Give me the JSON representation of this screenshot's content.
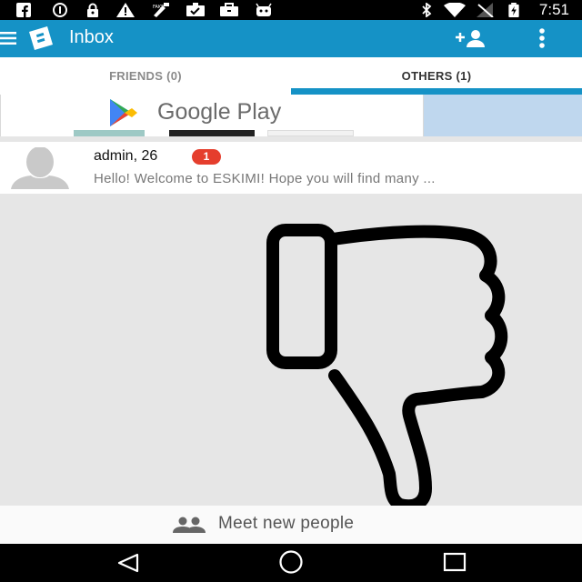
{
  "status_bar": {
    "time": "7:51",
    "icons": [
      "facebook-icon",
      "info-icon",
      "lock-icon",
      "warning-icon",
      "fake-gps-icon",
      "check-clipboard-icon",
      "briefcase-icon",
      "android-icon",
      "bluetooth-icon",
      "wifi-icon",
      "signal-icon",
      "battery-icon"
    ]
  },
  "app_bar": {
    "title": "Inbox",
    "icons": [
      "menu-icon",
      "eskimi-logo-icon",
      "add-person-icon",
      "more-vert-icon"
    ]
  },
  "tabs": [
    {
      "label": "FRIENDS (0)",
      "active": false
    },
    {
      "label": "OTHERS (1)",
      "active": true
    }
  ],
  "ad": {
    "text": "Google Play",
    "icon": "google-play-icon"
  },
  "messages": [
    {
      "name": "admin, 26",
      "unread": "1",
      "preview": "Hello! Welcome to ESKIMI! Hope you will find many ..."
    }
  ],
  "overlay": {
    "icon": "thumbs-down-icon"
  },
  "bottom_action": {
    "label": "Meet new people",
    "icon": "people-icon"
  },
  "nav_bar": {
    "icons": [
      "back-icon",
      "home-icon",
      "recents-icon"
    ]
  },
  "colors": {
    "primary": "#1592c6",
    "badge": "#e53e2d",
    "background": "#e6e6e6"
  }
}
